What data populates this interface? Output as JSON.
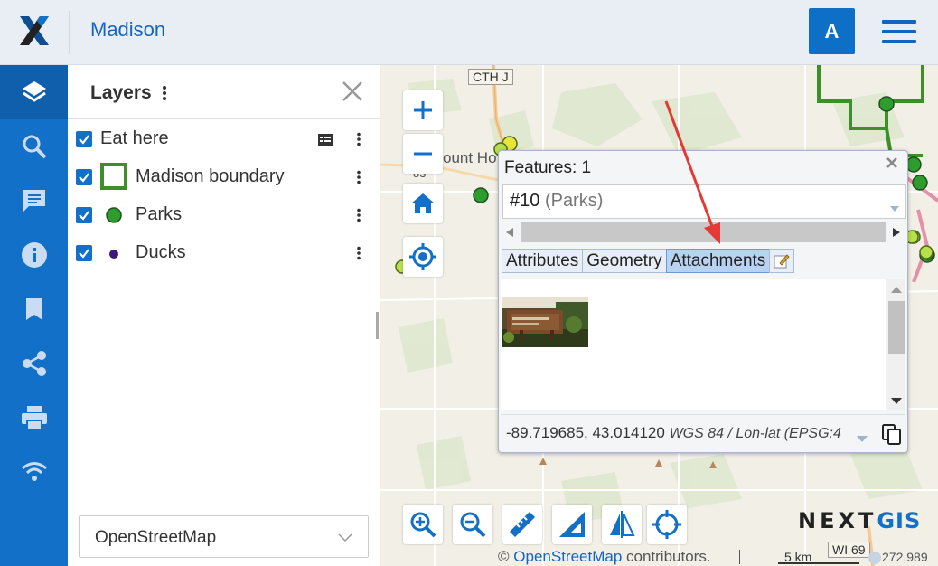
{
  "header": {
    "app_title": "Madison",
    "user_initial": "A"
  },
  "iconbar": {
    "items": [
      "layers-icon",
      "search-icon",
      "chat-icon",
      "info-icon",
      "bookmark-icon",
      "share-icon",
      "print-icon",
      "wifi-icon"
    ]
  },
  "layers_panel": {
    "title": "Layers",
    "layers": [
      {
        "name": "Eat here",
        "checked": true
      },
      {
        "name": "Madison boundary",
        "checked": true
      },
      {
        "name": "Parks",
        "checked": true
      },
      {
        "name": "Ducks",
        "checked": true
      }
    ],
    "basemap": "OpenStreetMap"
  },
  "map": {
    "road_label_top": "CTH J",
    "road_label_bottom": "WI 69",
    "place_fragment": "ount Ho",
    "place_fragment2": "83",
    "attribution_prefix": "©",
    "attribution_link": "OpenStreetMap",
    "attribution_suffix": "contributors.",
    "scale": "5 km",
    "scale_ratio": "272,989",
    "brand_next": "NEXT",
    "brand_gis": "GIS"
  },
  "popup": {
    "title": "Features: 1",
    "feature_id": "#10",
    "feature_layer": "(Parks)",
    "tabs": [
      "Attributes",
      "Geometry",
      "Attachments"
    ],
    "active_tab": "Attachments",
    "coordinates": "-89.719685, 43.014120",
    "crs": "WGS 84 / Lon-lat (EPSG:4"
  },
  "colors": {
    "primary": "#1370c9",
    "header_bg": "#e9eef5",
    "park_green": "#2e9d2e",
    "boundary_green": "#3d8f28",
    "annotation_red": "#e53935"
  }
}
